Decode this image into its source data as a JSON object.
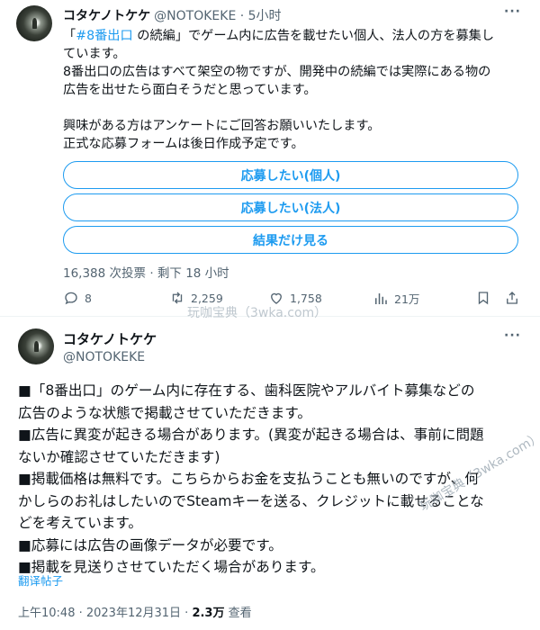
{
  "tweet1": {
    "author_name": "コタケノトケケ",
    "author_meta": "@NOTOKEKE · 5小时",
    "text_line1_prefix": "「",
    "text_line1_link": "#8番出口",
    "text_line1_suffix": " の続編」でゲーム内に広告を載せたい個人、法人の方を募集し",
    "text_line2": "ています。",
    "text_line3": "8番出口の広告はすべて架空の物ですが、開発中の続編では実際にある物の",
    "text_line4": "広告を出せたら面白そうだと思っています。",
    "text_line5": "興味がある方はアンケートにご回答お願いいたします。",
    "text_line6": "正式な応募フォームは後日作成予定です。",
    "poll_options": [
      "応募したい(個人)",
      "応募したい(法人)",
      "結果だけ見る"
    ],
    "poll_info": "16,388 次投票 · 剩下 18 小时",
    "actions": {
      "replies": "8",
      "reposts": "2,259",
      "likes": "1,758",
      "views": "21万"
    }
  },
  "watermark_1": "玩咖宝典（3wka.com）",
  "tweet2": {
    "author_name": "コタケノトケケ",
    "author_handle": "@NOTOKEKE",
    "lines": [
      "■「8番出口」のゲーム内に存在する、歯科医院やアルバイト募集などの",
      "広告のような状態で掲載させていただきます。",
      "■広告に異変が起きる場合があります。(異変が起きる場合は、事前に問題",
      "ないか確認させていただきます)",
      "■掲載価格は無料です。こちらからお金を支払うことも無いのですが、何",
      "かしらのお礼はしたいのでSteamキーを送る、クレジットに載せることな",
      "どを考えています。",
      "■応募には広告の画像データが必要です。",
      "■掲載を見送りさせていただく場合があります。"
    ],
    "translate_label": "翻译帖子",
    "footer_time": "上午10:48 · 2023年12月31日 · ",
    "footer_views": "2.3万",
    "footer_views_suffix": " 查看"
  },
  "watermark_2": "玩咖宝典（3wka.com）",
  "colors": {
    "accent": "#1d9bf0",
    "text": "#0f1419",
    "muted": "#536471"
  }
}
